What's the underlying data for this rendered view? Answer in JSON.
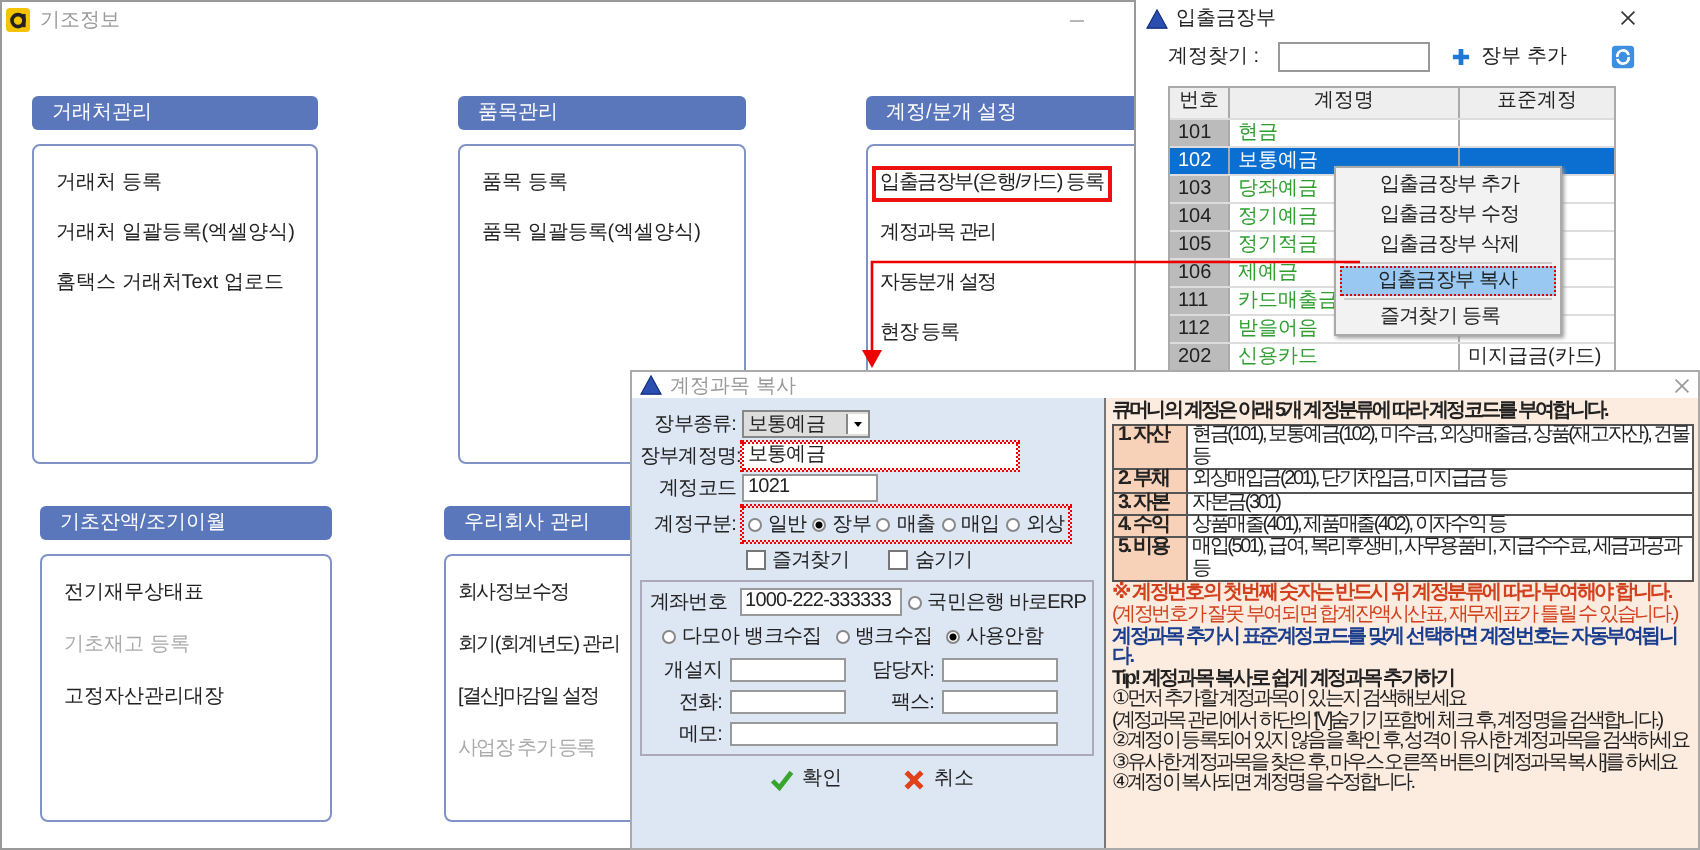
{
  "main_window": {
    "title": "기조정보"
  },
  "top_groups": [
    {
      "title": "거래처관리",
      "items": [
        {
          "label": "거래처 등록",
          "disabled": false,
          "highlighted": false
        },
        {
          "label": "거래처 일괄등록(엑셀양식)",
          "disabled": false,
          "highlighted": false
        },
        {
          "label": "홈택스 거래처Text 업로드",
          "disabled": false,
          "highlighted": false
        }
      ]
    },
    {
      "title": "품목관리",
      "items": [
        {
          "label": "품목 등록",
          "disabled": false,
          "highlighted": false
        },
        {
          "label": "품목 일괄등록(엑셀양식)",
          "disabled": false,
          "highlighted": false
        }
      ]
    },
    {
      "title": "계정/분개 설정",
      "items": [
        {
          "label": "입출금장부(은행/카드) 등록",
          "disabled": false,
          "highlighted": true
        },
        {
          "label": "계정과목 관리",
          "disabled": false,
          "highlighted": false
        },
        {
          "label": "자동분개 설정",
          "disabled": false,
          "highlighted": false
        },
        {
          "label": "현장 등록",
          "disabled": false,
          "highlighted": false
        }
      ]
    }
  ],
  "bottom_groups": [
    {
      "title": "기초잔액/조기이월",
      "items": [
        {
          "label": "전기재무상태표",
          "disabled": false,
          "highlighted": false
        },
        {
          "label": "기초재고 등록",
          "disabled": true,
          "highlighted": false
        },
        {
          "label": "고정자산관리대장",
          "disabled": false,
          "highlighted": false
        }
      ]
    },
    {
      "title": "우리회사 관리",
      "items": [
        {
          "label": "회사정보수정",
          "disabled": false,
          "highlighted": false
        },
        {
          "label": "회기(회계년도) 관리",
          "disabled": false,
          "highlighted": false
        },
        {
          "label": "[결산]마감일 설정",
          "disabled": false,
          "highlighted": false
        },
        {
          "label": "사업장 추가 등록",
          "disabled": true,
          "highlighted": false
        }
      ]
    }
  ],
  "ledger_window": {
    "title": "입출금장부",
    "search_label": "계정찾기 :",
    "add_button": "장부 추가",
    "columns": [
      "번호",
      "계정명",
      "표준계정"
    ],
    "rows": [
      {
        "code": "101",
        "name": "현금",
        "selected": false
      },
      {
        "code": "102",
        "name": "보통예금",
        "selected": true
      },
      {
        "code": "103",
        "name": "당좌예금",
        "selected": false
      },
      {
        "code": "104",
        "name": "정기예금",
        "selected": false
      },
      {
        "code": "105",
        "name": "정기적금",
        "selected": false
      },
      {
        "code": "106",
        "name": "제예금",
        "selected": false
      },
      {
        "code": "111",
        "name": "카드매출금",
        "selected": false
      },
      {
        "code": "112",
        "name": "받을어음",
        "selected": false
      },
      {
        "code": "202",
        "name": "신용카드",
        "standard": "미지급금(카드)",
        "selected": false
      }
    ]
  },
  "context_menu": [
    {
      "items": [
        {
          "label": "입출금장부 추가",
          "selected": false
        },
        {
          "label": "입출금장부 수정",
          "selected": false
        },
        {
          "label": "입출금장부 삭제",
          "selected": false
        }
      ]
    },
    {
      "items": [
        {
          "label": "입출금장부 복사",
          "selected": true
        }
      ]
    },
    {
      "items": [
        {
          "label": "즐겨찾기 등록",
          "selected": false
        }
      ]
    }
  ],
  "copy_dialog": {
    "title": "계정과목 복사",
    "ledger_type": {
      "label": "장부종류:",
      "value": "보통예금"
    },
    "ledger_name": {
      "label": "장부계정명:",
      "value": "보통예금",
      "highlighted": true
    },
    "account_code": {
      "label": "계정코드",
      "value": "1021"
    },
    "account_kind": {
      "label": "계정구분:",
      "highlighted": true,
      "options": [
        {
          "label": "일반",
          "selected": false
        },
        {
          "label": "장부",
          "selected": true
        },
        {
          "label": "매출",
          "selected": false
        },
        {
          "label": "매입",
          "selected": false
        },
        {
          "label": "외상",
          "selected": false
        }
      ]
    },
    "checkboxes": [
      {
        "label": "즐겨찾기",
        "checked": false
      },
      {
        "label": "숨기기",
        "checked": false
      }
    ],
    "account_number": {
      "label": "계좌번호",
      "value": "1000-222-333333"
    },
    "bank_options": [
      {
        "label": "국민은행 바로ERP",
        "selected": false
      },
      {
        "label": "다모아 뱅크수집",
        "selected": false
      },
      {
        "label": "뱅크수집",
        "selected": false
      },
      {
        "label": "사용안함",
        "selected": true
      }
    ],
    "contact_fields": [
      {
        "label": "개설지"
      },
      {
        "label": "담당자:"
      },
      {
        "label": "전화:"
      },
      {
        "label": "팩스:"
      },
      {
        "label": "메모:"
      }
    ],
    "buttons": [
      {
        "label": "확인",
        "kind": "confirm"
      },
      {
        "label": "취소",
        "kind": "cancel"
      }
    ]
  },
  "info_panel": {
    "heading": "큐머니의 계정은 아래 5개 계정분류에 따라 계정코드를 부여합니다.",
    "categories": [
      {
        "name": "1. 자산",
        "examples": "현금(101), 보통예금(102), 미수금, 외상매출금, 상품(재고자산), 건물 등"
      },
      {
        "name": "2. 부채",
        "examples": "외상매입금(201), 단기차입금, 미지급금 등"
      },
      {
        "name": "3. 자본",
        "examples": "자본금(301)"
      },
      {
        "name": "4. 수익",
        "examples": "상품매출(401), 제품매출(402), 이자수익 등"
      },
      {
        "name": "5. 비용",
        "examples": "매입(501), 급여, 복리후생비, 사무용품비, 지급수수료, 세금과공과 등"
      }
    ],
    "warning": "※ 계정번호의 첫번째 숫자는 반드시 위 계정분류에 따라 부여해야 합니다.",
    "warning_note": "(계정번호가 잘못 부여되면 합계잔액시산표, 재무제표가 틀릴 수 있습니다.)",
    "auto_note": "계정과목 추가시 표준계정코드를 맞게 선택하면 계정번호는 자동부여됩니다.",
    "tip_title": "Tip! 계정과목 복사로 쉽게 계정과목 추가하기",
    "steps": [
      "①먼저 추가할 계정과목이 있는지 검색해보세요",
      "(계정과목 관리에서 하단의 '[V]숨기기포함'에 체크 후, 계정명을 검색합니다.)",
      "②계정이 등록되어 있지 않음을 확인 후, 성격이 유사한 계정과목을 검색하세요",
      "③유사한 계정과목을 찾은 후, 마우스 오른쪽 버튼의 [계정과목 복사]를 하세요",
      "④계정이 복사되면 계정명을 수정합니다."
    ]
  }
}
